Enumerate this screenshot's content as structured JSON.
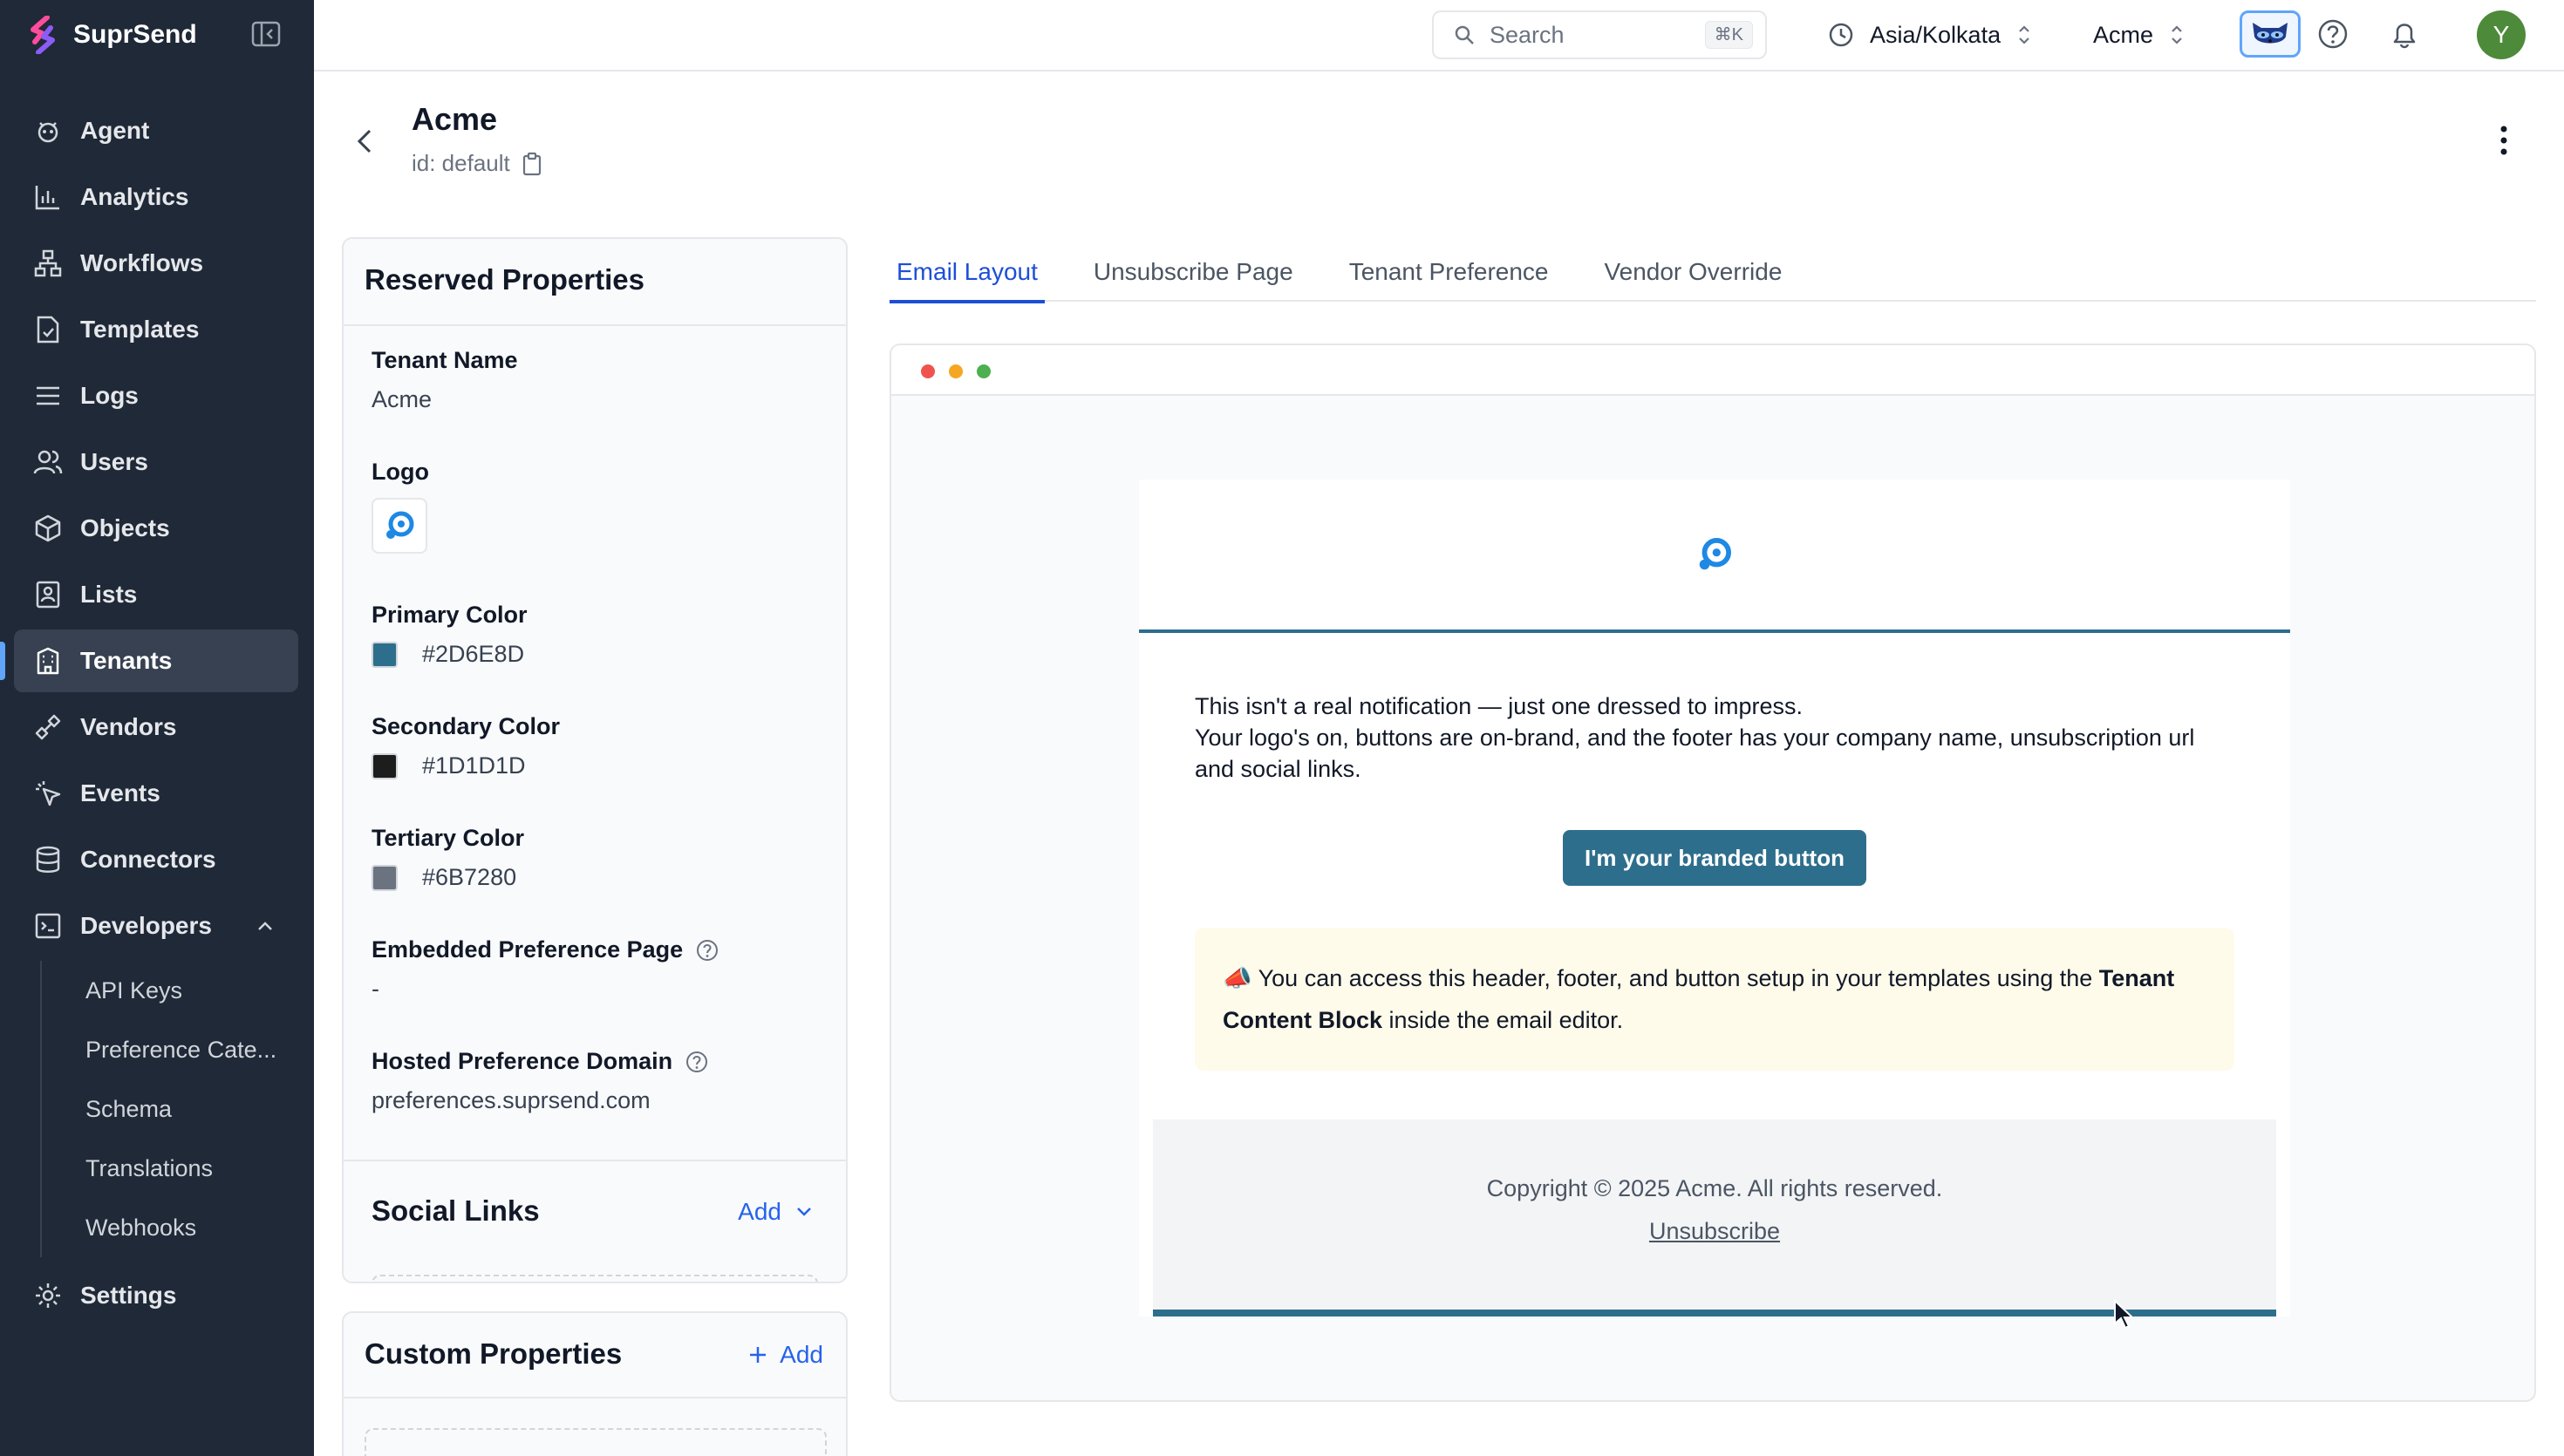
{
  "app": {
    "name": "SuprSend"
  },
  "sidebar": {
    "items": [
      {
        "label": "Agent",
        "icon": "agent-icon"
      },
      {
        "label": "Analytics",
        "icon": "analytics-icon"
      },
      {
        "label": "Workflows",
        "icon": "workflows-icon"
      },
      {
        "label": "Templates",
        "icon": "templates-icon"
      },
      {
        "label": "Logs",
        "icon": "logs-icon"
      },
      {
        "label": "Users",
        "icon": "users-icon"
      },
      {
        "label": "Objects",
        "icon": "objects-icon"
      },
      {
        "label": "Lists",
        "icon": "lists-icon"
      },
      {
        "label": "Tenants",
        "icon": "tenants-icon",
        "active": true
      },
      {
        "label": "Vendors",
        "icon": "vendors-icon"
      },
      {
        "label": "Events",
        "icon": "events-icon"
      },
      {
        "label": "Connectors",
        "icon": "connectors-icon"
      },
      {
        "label": "Developers",
        "icon": "developers-icon",
        "expanded": true
      }
    ],
    "developers_sub": [
      "API Keys",
      "Preference Cate...",
      "Schema",
      "Translations",
      "Webhooks"
    ],
    "settings": {
      "label": "Settings",
      "icon": "settings-icon"
    }
  },
  "topbar": {
    "search_placeholder": "Search",
    "search_shortcut": "⌘K",
    "timezone": "Asia/Kolkata",
    "org": "Acme",
    "avatar_initial": "Y"
  },
  "page": {
    "title": "Acme",
    "id_text": "id: default"
  },
  "reserved": {
    "title": "Reserved Properties",
    "tenant_name_label": "Tenant Name",
    "tenant_name_value": "Acme",
    "logo_label": "Logo",
    "primary_label": "Primary Color",
    "primary_value": "#2D6E8D",
    "secondary_label": "Secondary Color",
    "secondary_value": "#1D1D1D",
    "tertiary_label": "Tertiary Color",
    "tertiary_value": "#6B7280",
    "embedded_label": "Embedded Preference Page",
    "embedded_value": "-",
    "hosted_label": "Hosted Preference Domain",
    "hosted_value": "preferences.suprsend.com"
  },
  "social": {
    "title": "Social Links",
    "add_label": "Add"
  },
  "custom": {
    "title": "Custom Properties",
    "add_label": "Add"
  },
  "tabs": [
    {
      "label": "Email Layout",
      "active": true
    },
    {
      "label": "Unsubscribe Page"
    },
    {
      "label": "Tenant Preference"
    },
    {
      "label": "Vendor Override"
    }
  ],
  "email": {
    "line1": "This isn't a real notification — just one dressed to impress.",
    "line2": "Your logo's on, buttons are on-brand, and the footer has your company name, unsubscription url and social links.",
    "button": "I'm your branded button",
    "note_prefix": "📣 You can access this header, footer, and button setup in your templates using the ",
    "note_bold": "Tenant Content Block",
    "note_suffix": " inside the email editor.",
    "copyright": "Copyright © 2025 Acme. All rights reserved.",
    "unsubscribe": "Unsubscribe"
  },
  "colors": {
    "primary": "#2D6E8D",
    "secondary": "#1D1D1D",
    "tertiary": "#6B7280",
    "sidebar_bg": "#1f2937",
    "accent": "#1d4ed8"
  }
}
